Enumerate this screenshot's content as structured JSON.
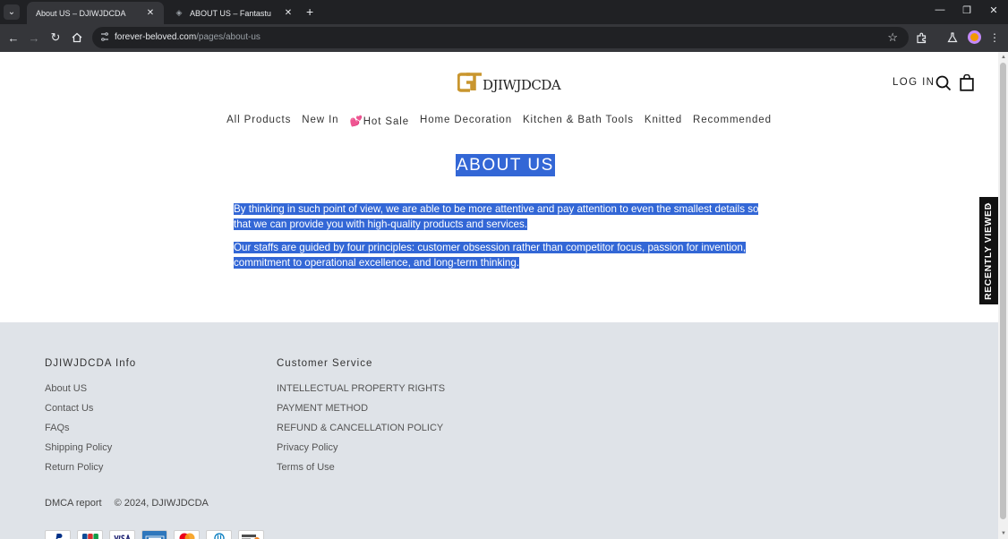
{
  "browser": {
    "tabs": [
      {
        "title": "About US – DJIWJDCDA",
        "active": true
      },
      {
        "title": "ABOUT US – Fantastu",
        "active": false
      }
    ],
    "url_host": "forever-beloved.com",
    "url_path": "/pages/about-us"
  },
  "header": {
    "brand": "DJIWJDCDA",
    "login": "LOG IN"
  },
  "nav": [
    "All Products",
    "New In",
    "💕Hot Sale",
    "Home Decoration",
    "Kitchen & Bath Tools",
    "Knitted",
    "Recommended"
  ],
  "page": {
    "title": "ABOUT US",
    "paragraphs": [
      "By thinking in such point of view, we are able to be more attentive and pay attention to even the smallest details so that we can provide you with high-quality products and services.",
      "Our staffs are guided by four principles: customer obsession rather than competitor focus, passion for invention, commitment to operational excellence, and long-term thinking."
    ]
  },
  "recently_viewed": "RECENTLY VIEWED",
  "footer": {
    "info_heading": "DJIWJDCDA Info",
    "info_links": [
      "About US",
      "Contact Us",
      "FAQs",
      "Shipping Policy",
      "Return Policy"
    ],
    "service_heading": "Customer Service",
    "service_links": [
      "INTELLECTUAL PROPERTY RIGHTS",
      "PAYMENT METHOD",
      "REFUND & CANCELLATION POLICY",
      "Privacy Policy",
      "Terms of Use"
    ],
    "dmca": "DMCA report",
    "copyright": "© 2024, DJIWJDCDA",
    "payment_icons": [
      "paypal-icon",
      "jcb-icon",
      "visa-icon",
      "amex-icon",
      "mastercard-icon",
      "diners-icon",
      "discover-icon"
    ]
  },
  "colors": {
    "selection": "#3367d6",
    "footer_bg": "#dfe3e8",
    "chrome_dark": "#202124",
    "chrome_toolbar": "#35363a",
    "logo_gold": "#c9962f"
  }
}
